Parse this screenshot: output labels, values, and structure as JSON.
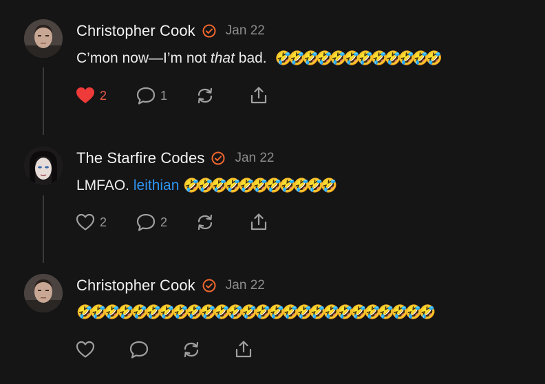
{
  "posts": [
    {
      "author": "Christopher Cook",
      "date": "Jan 22",
      "text_before": "C’mon now—I’m not ",
      "text_italic": "that",
      "text_after": " bad. ",
      "emojis": "🤣🤣🤣🤣🤣🤣🤣🤣🤣🤣🤣🤣",
      "likes": "2",
      "liked": true,
      "replies": "1"
    },
    {
      "author": "The Starfire Codes",
      "date": "Jan 22",
      "text_before": "LMFAO. ",
      "mention": "leithian",
      "emojis": "🤣🤣🤣🤣🤣🤣🤣🤣🤣🤣🤣",
      "likes": "2",
      "replies": "2"
    },
    {
      "author": "Christopher Cook",
      "date": "Jan 22",
      "emojis": "🤣🤣🤣🤣🤣🤣🤣🤣🤣🤣🤣🤣🤣🤣🤣🤣🤣🤣🤣🤣🤣🤣🤣🤣🤣🤣"
    }
  ],
  "icons": {
    "heart_filled": "heart-icon",
    "heart_outline": "heart-outline-icon",
    "comment": "comment-icon",
    "repost": "repost-icon",
    "share": "share-icon",
    "verified": "verified-badge-icon"
  },
  "colors": {
    "background": "#151516",
    "verified": "#f0672c",
    "like_active": "#ef3a3a",
    "link": "#2f95f3",
    "muted": "#8c8c8c"
  }
}
